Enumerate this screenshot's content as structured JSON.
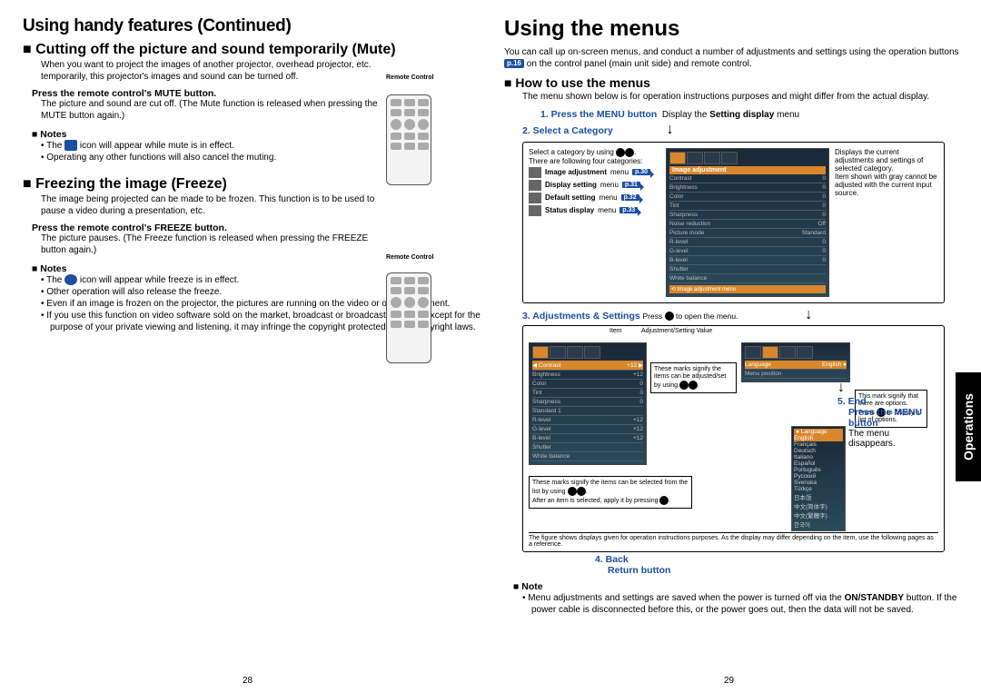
{
  "left": {
    "heading": "Using handy features (Continued)",
    "mute": {
      "title": "Cutting off the picture and sound temporarily (Mute)",
      "intro": "When you want to project the images of another projector, overhead projector, etc. temporarily, this projector's images and sound can be turned off.",
      "remote_label": "Remote\nControl",
      "step": "Press the remote control's MUTE button.",
      "step_body": "The picture and sound are cut off. (The Mute function is released when pressing the MUTE button again.)",
      "notes_hd": "Notes",
      "notes": [
        "The   icon will appear while mute is in effect.",
        "Operating any other functions will also cancel the muting."
      ]
    },
    "freeze": {
      "title": "Freezing the image (Freeze)",
      "intro": "The image being projected can be made to be frozen. This function is to be used to pause a video during a presentation, etc.",
      "remote_label": "Remote\nControl",
      "step": "Press the remote control's FREEZE button.",
      "step_body": "The picture pauses. (The Freeze function is released when pressing the FREEZE button again.)",
      "notes_hd": "Notes",
      "notes": [
        "The   icon will appear while freeze is in effect.",
        "Other operation will also release the freeze.",
        "Even if an image is frozen on the projector, the pictures are running on the video or other equipment.",
        "If you use this function on video software sold on the market, broadcast or broadcast on cable except for the purpose of your private viewing and listening, it may infringe the copyright protected by the copyright laws."
      ]
    },
    "page_num": "28"
  },
  "right": {
    "heading": "Using the menus",
    "intro": "You can call up on-screen menus, and conduct a number of adjustments and settings using the operation buttons   on the control panel (main unit side) and remote control.",
    "pref_intro": "p.16",
    "howto": {
      "title": "How to use the menus",
      "body": "The menu shown below is for operation instructions purposes and might differ from the actual display."
    },
    "step1": {
      "label": "1. Press the MENU button",
      "after": "Display the ",
      "after_bold": "Setting display",
      "after2": " menu"
    },
    "step2": {
      "label": "2. Select a Category"
    },
    "catbox": {
      "hint1": "Select a category by using ",
      "hint2": ". There are following four categories:",
      "items": [
        {
          "name": "Image adjustment",
          "suffix": " menu",
          "page": "p.30"
        },
        {
          "name": "Display setting",
          "suffix": " menu",
          "page": "p.31"
        },
        {
          "name": "Default setting",
          "suffix": " menu",
          "page": "p.32"
        },
        {
          "name": "Status display",
          "suffix": " menu",
          "page": "p.33"
        }
      ],
      "right_text": "Displays the current adjustments and settings of selected category.\nItem shown with gray cannot be adjusted with the current input source.",
      "osd": {
        "title": "Image adjustment",
        "rows": [
          [
            "Contrast",
            "0"
          ],
          [
            "Brightness",
            "0"
          ],
          [
            "Color",
            "0"
          ],
          [
            "Tint",
            "0"
          ],
          [
            "Sharpness",
            "0"
          ],
          [
            "Noise reduction",
            "Off"
          ],
          [
            "Picture mode",
            "Standard"
          ],
          [
            "R-level",
            "0"
          ],
          [
            "G-level",
            "0"
          ],
          [
            "B-level",
            "0"
          ],
          [
            "Shutter",
            ""
          ],
          [
            "White balance",
            ""
          ]
        ],
        "footer": "Image adjustment menu"
      }
    },
    "step3": {
      "label": "3. Adjustments & Settings",
      "after": "Press ",
      "after2": " to open the menu."
    },
    "step4": {
      "label": "4. Back",
      "sub": "Return button"
    },
    "step5": {
      "label": "5. End",
      "sub": "Press the MENU button",
      "body": "The menu disappears."
    },
    "adj": {
      "item_label": "Item",
      "adj_value_label": "Adjustment/Setting Value",
      "mark_adj": "These marks signify the items can be adjusted/set by using ",
      "mark_sel": "These marks signify the items can be selected from the list by using ",
      "mark_sel2": "After an item is selected, apply it by pressing ",
      "opt_mark": "This mark signify that there are options. Press   to display a list of options.",
      "footer": "The figure shows displays given for operation instructions purposes.  As the display may differ depending on the item, use the following pages as a reference.",
      "lang_list": [
        "English",
        "Français",
        "Deutsch",
        "Italiano",
        "Español",
        "Português",
        "Русский",
        "Svenska",
        "Türkçe",
        "日本語",
        "中文(简体字)",
        "中文(繁體字)",
        "한국어"
      ]
    },
    "note_hd": "Note",
    "note_body": "Menu adjustments and settings are saved when the power is turned off via the ON/STANDBY button. If the power cable is disconnected before this, or the power goes out, then the data will not be saved.",
    "page_num": "29",
    "side_tab": "Operations"
  }
}
